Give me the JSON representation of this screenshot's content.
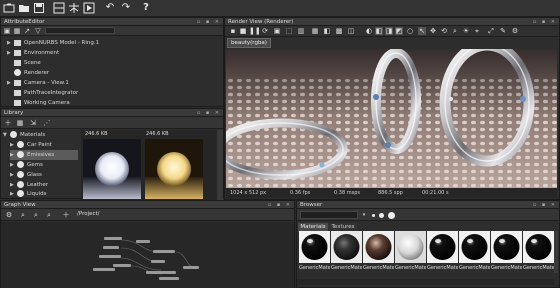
{
  "toolbar": {
    "icons": [
      "folder-new-icon",
      "folder-open-icon",
      "save-icon",
      "render-settings-icon",
      "scene-icon",
      "play-icon",
      "undo-icon",
      "redo-icon",
      "help-icon"
    ],
    "help_label": "?"
  },
  "attribute_editor": {
    "title": "AttributeEditor",
    "items": [
      {
        "label": "OpenNURBS Model - Ring.1",
        "icon": "model-icon",
        "expandable": true
      },
      {
        "label": "Environment",
        "icon": "environment-icon",
        "expandable": true
      },
      {
        "label": "Scene",
        "icon": "scene-icon",
        "expandable": false
      },
      {
        "label": "Renderer",
        "icon": "renderer-icon",
        "expandable": false
      },
      {
        "label": "Camera - View.1",
        "icon": "camera-icon",
        "expandable": true
      },
      {
        "label": "PathTraceIntegrator",
        "icon": "integrator-icon",
        "expandable": false
      },
      {
        "label": "Working Camera",
        "icon": "camera-icon",
        "expandable": false
      }
    ]
  },
  "library": {
    "title": "Library",
    "tree": [
      {
        "label": "Materials",
        "expanded": true
      },
      {
        "label": "Car Paint",
        "expanded": false
      },
      {
        "label": "Emissives",
        "expanded": false,
        "selected": true
      },
      {
        "label": "Gems",
        "expanded": false
      },
      {
        "label": "Glass",
        "expanded": false
      },
      {
        "label": "Leather",
        "expanded": false
      },
      {
        "label": "Liquids",
        "expanded": false
      }
    ],
    "thumbs": [
      {
        "size": "246.6 KB"
      },
      {
        "size": "246.6 KB"
      }
    ]
  },
  "render_view": {
    "title": "Render View (Renderer)",
    "tab": "beauty(rgba)",
    "status": {
      "resolution": "1024 x 512 px",
      "fps": "0.36 fps",
      "msps": "0.38 msps",
      "spp": "886.5 spp",
      "time": "00:21.00 s"
    }
  },
  "graph_view": {
    "title": "Graph View",
    "path": "/Project/"
  },
  "browser": {
    "title": "Browser",
    "tabs": [
      "Materials",
      "Textures"
    ],
    "items": [
      {
        "label": "GenericMate",
        "style": "black"
      },
      {
        "label": "GenericMate",
        "style": "dark"
      },
      {
        "label": "GenericMate",
        "style": "copper"
      },
      {
        "label": "GenericMate",
        "style": "white"
      },
      {
        "label": "GenericMate",
        "style": "black"
      },
      {
        "label": "GenericMate",
        "style": "black"
      },
      {
        "label": "GenericMate",
        "style": "black"
      },
      {
        "label": "GenericMate",
        "style": "black"
      }
    ]
  },
  "colors": {
    "panel_bg": "#2d2d2d",
    "header_bg": "#3a3a3a",
    "selection": "#5b5b5b"
  }
}
